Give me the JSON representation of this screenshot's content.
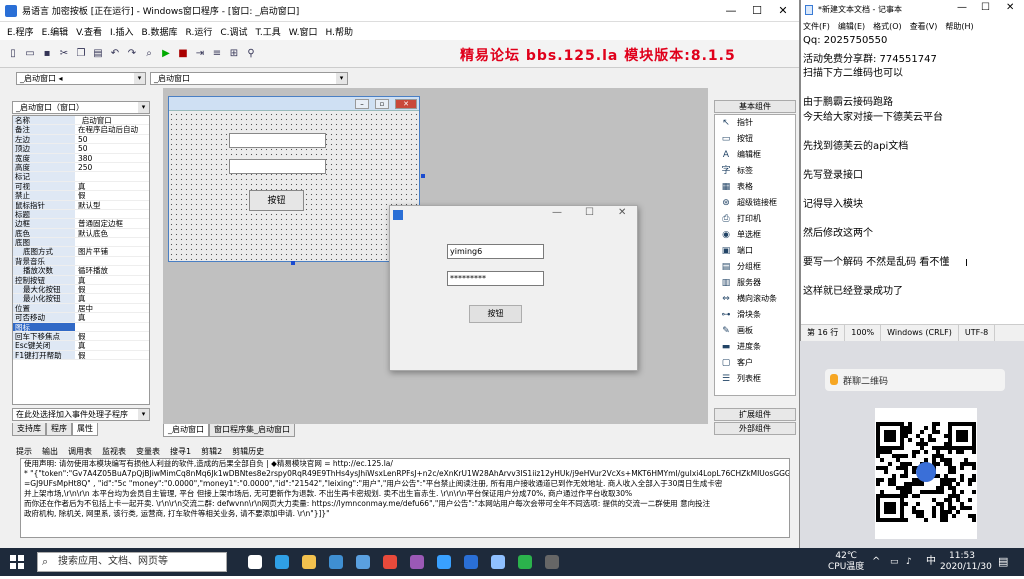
{
  "ide": {
    "title": "易语言 加密按板 [正在运行] - Windows窗口程序 - [窗口: _启动窗口]",
    "menu": [
      "E.程序",
      "E.编辑",
      "V.查看",
      "I.插入",
      "B.数据库",
      "R.运行",
      "C.调试",
      "T.工具",
      "W.窗口",
      "H.帮助"
    ],
    "brand": "精易论坛 bbs.125.la 模块版本:8.1.5",
    "combo_left": "_启动窗口 ◂",
    "combo_mid": "_启动窗口",
    "prop_combo": "_启动窗口（窗口）",
    "properties": [
      {
        "k": "名称",
        "v": "_启动窗口"
      },
      {
        "k": "备注",
        "v": "在程序启动后自动"
      },
      {
        "k": "左边",
        "v": "50"
      },
      {
        "k": "顶边",
        "v": "50"
      },
      {
        "k": "宽度",
        "v": "380"
      },
      {
        "k": "高度",
        "v": "250"
      },
      {
        "k": "标记",
        "v": ""
      },
      {
        "k": "可视",
        "v": "真"
      },
      {
        "k": "禁止",
        "v": "假"
      },
      {
        "k": "鼠标指针",
        "v": "默认型"
      },
      {
        "k": "标题",
        "v": ""
      },
      {
        "k": "边框",
        "v": "普通固定边框"
      },
      {
        "k": "底色",
        "v": "默认底色"
      },
      {
        "k": "底图",
        "v": ""
      },
      {
        "k": "底图方式",
        "v": "图片平铺",
        "sub": true
      },
      {
        "k": "背景音乐",
        "v": ""
      },
      {
        "k": "播放次数",
        "v": "循环播放",
        "sub": true
      },
      {
        "k": "控制按钮",
        "v": "真"
      },
      {
        "k": "最大化按钮",
        "v": "假",
        "sub": true
      },
      {
        "k": "最小化按钮",
        "v": "真",
        "sub": true
      },
      {
        "k": "位置",
        "v": "居中"
      },
      {
        "k": "可否移动",
        "v": "真"
      },
      {
        "k": "图标",
        "v": "",
        "sel": true
      },
      {
        "k": "回车下移焦点",
        "v": "假"
      },
      {
        "k": "Esc键关闭",
        "v": "真"
      },
      {
        "k": "F1键打开帮助",
        "v": "假"
      }
    ],
    "event_combo": "在此处选择加入事件处理子程序",
    "left_tabs": [
      "支持库",
      "程序",
      "属性"
    ],
    "design_tabs": [
      "_启动窗口",
      "窗口程序集_启动窗口"
    ],
    "form_button": "按钮",
    "tools_header": "基本组件",
    "tools": [
      {
        "icon": "cursor-icon",
        "g": "↖",
        "label": "指针"
      },
      {
        "icon": "button-icon",
        "g": "▭",
        "label": "按钮"
      },
      {
        "icon": "editbox-icon",
        "g": "A",
        "label": "编辑框"
      },
      {
        "icon": "label-icon",
        "g": "字",
        "label": "标签"
      },
      {
        "icon": "table-icon",
        "g": "▦",
        "label": "表格"
      },
      {
        "icon": "hyperlink-icon",
        "g": "⊛",
        "label": "超级链接框"
      },
      {
        "icon": "printer-icon",
        "g": "⎙",
        "label": "打印机"
      },
      {
        "icon": "radio-icon",
        "g": "◉",
        "label": "单选框"
      },
      {
        "icon": "port-icon",
        "g": "▣",
        "label": "端口"
      },
      {
        "icon": "divider-icon",
        "g": "▤",
        "label": "分组框"
      },
      {
        "icon": "server-icon",
        "g": "▥",
        "label": "服务器"
      },
      {
        "icon": "hscroll-icon",
        "g": "⇔",
        "label": "横向滚动条"
      },
      {
        "icon": "slider-icon",
        "g": "⊶",
        "label": "滑块条"
      },
      {
        "icon": "canvas-icon",
        "g": "✎",
        "label": "画板"
      },
      {
        "icon": "progress-icon",
        "g": "▬",
        "label": "进度条"
      },
      {
        "icon": "client-icon",
        "g": "▢",
        "label": "客户"
      },
      {
        "icon": "listbox-icon",
        "g": "☰",
        "label": "列表框"
      }
    ],
    "tools_ext": "扩展组件",
    "tools_ext2": "外部组件",
    "output_tabs": [
      "提示",
      "输出",
      "调用表",
      "监视表",
      "变量表",
      "搜寻1",
      "剪辑2",
      "剪辑历史"
    ],
    "output_lines": [
      "使用声明: 请勿使用本模块编写有损他人利益的软件,造成的后果全部自负  | ◆精易模块官网  = http://ec.125.la/",
      "* \"{\"token\":\"Gv7A4Z05BuA7pQjBJiwMimCq8nMq6Jk1wDBNtes8e2rspy0RqR49E9ThHs4ysJhiWsxLenRPFsJ+n2c/eXnKrU1W28AhArvv3IS1iiz12yHUk/j9eHVur2VcXs+MKT6HMYmI/guIxi4LopL76CHZkMIUosGGG",
      "=GJ9UFsMpHt8Q\" , \"id\":\"5c \"money\":\"0.0000\",\"money1\":\"0.0000\",\"id\":\"21542\",\"leixing\":\"用户\",\"用户公告\":\"平台禁止阅读注册, 所有用户接收通道已到作无效地址. 商人收入全部入于30周日生成卡密",
      "并上架市场,\\r\\n\\r\\n 本平台均为会员自主管理, 平台 但接上架市场后, 无可更新作为退款. 不出生再卡密规划. 卖不出生盲赤生. \\r\\n\\r\\n平台保证用户分成70%, 商户通过作平台收取30%",
      "而你还在作者后为不包括上卡一起开卖. \\r\\n\\r\\n交流二群: defwvnn\\r\\n网页大力卖量: https://lymnconmay.me/defu66\",\"用户公告\":\"本网站用户每次会带可全年不同选项: 提供的交流一二群使用 意向投注",
      "政府机构, 除机关, 网里系, 该行类, 运营商, 打车软件等相关业务, 请不要添加申请. \\r\\n\"}]}\""
    ],
    "login": {
      "username": "yiming6",
      "password": "*********",
      "button": "按钮"
    }
  },
  "notepad": {
    "title": "*新建文本文档 - 记事本",
    "menu": [
      "文件(F)",
      "编辑(E)",
      "格式(O)",
      "查看(V)",
      "帮助(H)"
    ],
    "lines": [
      "Qq: 2025750550",
      "活动免费分享群: 774551747",
      "扫描下方二维码也可以",
      "",
      "由于鹏霸云接码跑路",
      "今天给大家对接一下德芙云平台",
      "",
      "先找到德芙云的api文档",
      "",
      "先写登录接口",
      "",
      "记得导入模块",
      "",
      "然后修改这两个",
      "",
      "要写一个解码  不然是乱码 看不懂",
      "",
      "这样就已经登录成功了"
    ],
    "status": [
      "第 16 行",
      "100%",
      "Windows (CRLF)",
      "UTF-8"
    ]
  },
  "qr": {
    "title": "群聊二维码"
  },
  "taskbar": {
    "search_placeholder": "搜索应用、文档、网页等",
    "weather_temp": "42℃",
    "weather_label": "CPU温度",
    "ime": "中",
    "time": "11:53",
    "date": "2020/11/30"
  },
  "colors": {
    "brand_red": "#e0001b",
    "selection": "#3169c6",
    "taskbar": "#1e2a3b"
  }
}
